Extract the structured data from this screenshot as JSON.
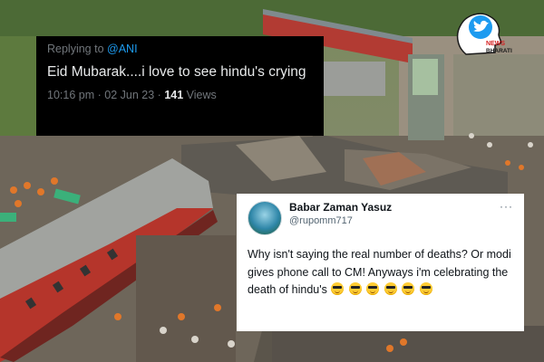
{
  "dark_tweet": {
    "replying_to_prefix": "Replying to",
    "replying_to_handle": "@ANI",
    "text": "Eid Mubarak....i love to see hindu's crying",
    "time": "10:16 pm",
    "separator": "·",
    "date": "02 Jun 23",
    "views_count": "141",
    "views_label": "Views"
  },
  "light_tweet": {
    "display_name": "Babar Zaman Yasuz",
    "handle": "@rupomm717",
    "more_icon": "more-icon",
    "text": "Why isn't saying the real number of deaths? Or modi gives phone call to CM! Anyways i'm celebrating the death  of hindu's",
    "emoji_count": 6,
    "emoji_icon": "sunglasses-emoji"
  },
  "logo": {
    "line1": "NEWS",
    "line2": "BHARATI",
    "accent_color": "#d62020",
    "bird_color": "#1d9bf0"
  },
  "colors": {
    "dark_card": "#000000",
    "light_card": "#ffffff",
    "mention": "#1d9bf0",
    "muted": "#71767b",
    "train_coach_red": "#b5352b",
    "train_coach_grey": "#8a8f96"
  }
}
